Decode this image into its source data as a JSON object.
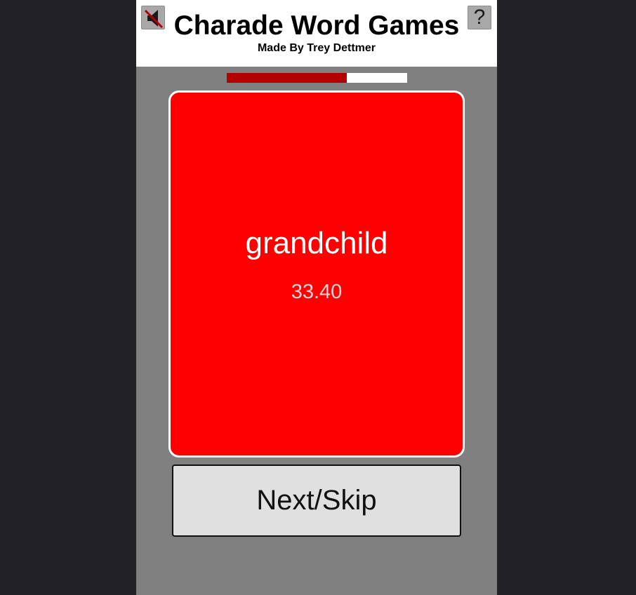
{
  "header": {
    "title": "Charade Word Games",
    "subtitle": "Made By Trey Dettmer",
    "mute_icon": "speaker-muted-icon",
    "help_label": "?"
  },
  "progress": {
    "fraction": 0.665,
    "fill_color": "#b30000"
  },
  "card": {
    "word": "grandchild",
    "timer": "33.40",
    "background_color": "#ff0000"
  },
  "controls": {
    "next_label": "Next/Skip"
  }
}
